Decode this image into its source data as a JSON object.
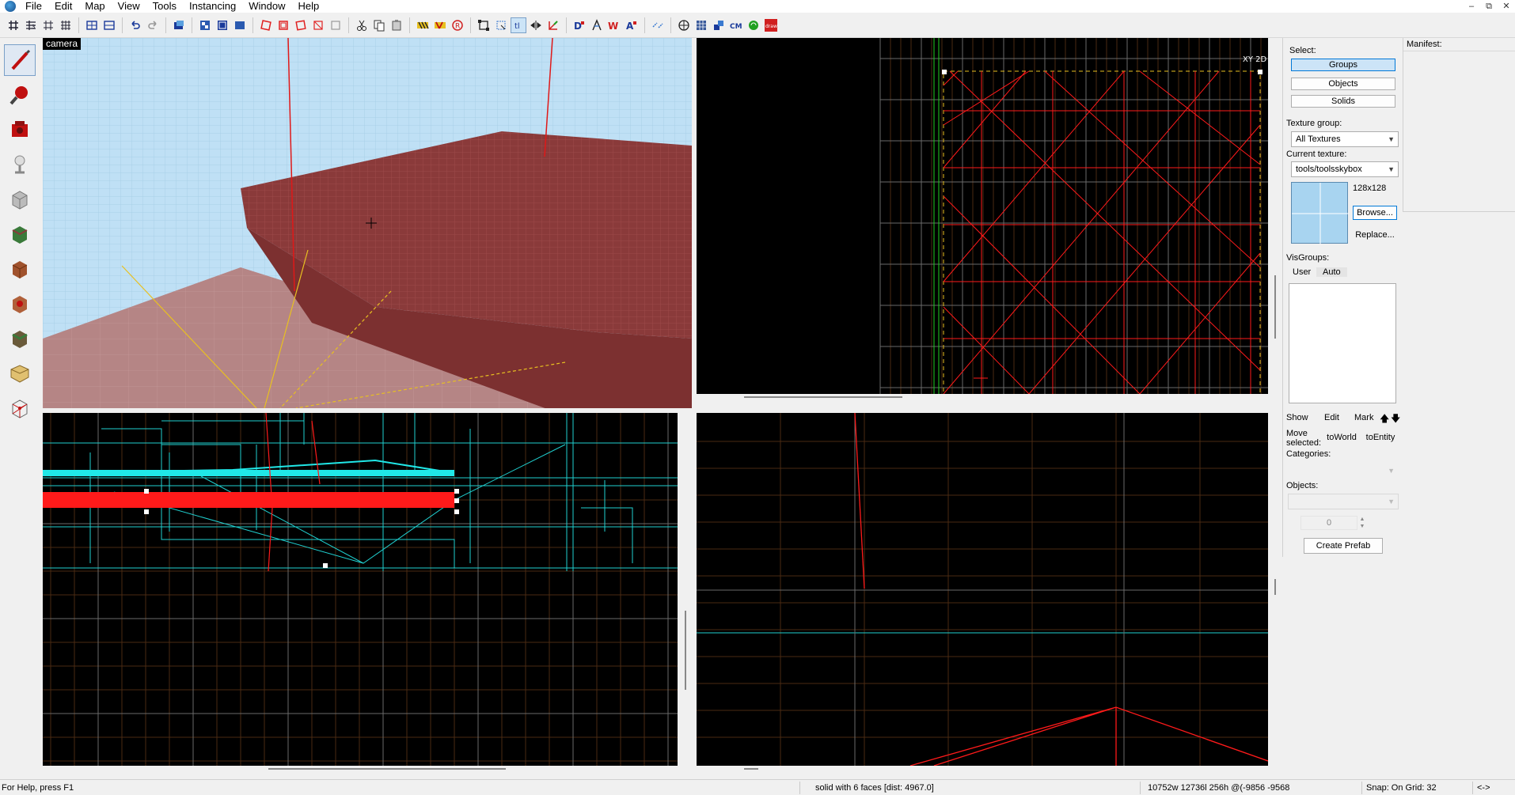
{
  "menu": {
    "items": [
      "File",
      "Edit",
      "Map",
      "View",
      "Tools",
      "Instancing",
      "Window",
      "Help"
    ]
  },
  "window_controls": {
    "minimize": "–",
    "restore": "⧉",
    "close": "✕"
  },
  "toolbar": {
    "icons": [
      "grid-toggle-icon",
      "grid-3d-icon",
      "grid-smaller-icon",
      "grid-larger-icon",
      "load-window-state-icon",
      "save-window-state-icon",
      "undo-icon",
      "redo-icon",
      "carve-icon",
      "group-icon",
      "ungroup-icon",
      "hide-icon",
      "unhide-icon",
      "toggle-visgroup-icon",
      "cut-icon",
      "copy-icon",
      "paste-icon",
      "texture-lock-icon",
      "texture-scale-icon",
      "autohide-icon",
      "selection-box-icon",
      "select-by-handles-icon",
      "texture-lock-2-icon",
      "flip-horizontal-icon",
      "flip-vertical-icon",
      "entity-report-icon",
      "check-problems-icon",
      "run-map-icon",
      "quick-hide-icon",
      "cordon-icon",
      "animation-icon",
      "smoothing-icon",
      "displacement-icon",
      "cubemap-icon",
      "sound-icon",
      "draw-icon"
    ],
    "cm_label": "CM",
    "draw_label": "draw"
  },
  "left_tools": [
    "selection-tool-icon",
    "magnify-tool-icon",
    "camera-tool-icon",
    "entity-tool-icon",
    "block-tool-icon",
    "toggle-texture-icon",
    "apply-texture-icon",
    "decal-tool-icon",
    "overlay-tool-icon",
    "clipping-tool-icon",
    "vertex-tool-icon"
  ],
  "viewports": {
    "camera_label": "camera",
    "top_right_label": "XY 2D"
  },
  "right_panel": {
    "select_label": "Select:",
    "groups_button": "Groups",
    "objects_button": "Objects",
    "solids_button": "Solids",
    "texture_group_label": "Texture group:",
    "texture_group_value": "All Textures",
    "current_texture_label": "Current texture:",
    "current_texture_value": "tools/toolsskybox",
    "texture_size": "128x128",
    "browse_button": "Browse...",
    "replace_button": "Replace...",
    "visgroups_label": "VisGroups:",
    "tab_user": "User",
    "tab_auto": "Auto",
    "show_button": "Show",
    "edit_button": "Edit",
    "mark_button": "Mark",
    "up_arrow": "🡅",
    "down_arrow": "🡇",
    "move_selected_label": "Move selected:",
    "to_world_button": "toWorld",
    "to_entity_button": "toEntity",
    "categories_label": "Categories:",
    "objects_label": "Objects:",
    "stepper_value": "0",
    "create_prefab_button": "Create Prefab"
  },
  "manifest": {
    "label": "Manifest:"
  },
  "status": {
    "help": "For Help, press F1",
    "selection": "solid with 6 faces   [dist: 4967.0]",
    "size": "10752w 12736l 256h @(-9856 -9568",
    "snap": "Snap: On Grid: 32",
    "arrows": "<->"
  },
  "colors": {
    "sky": "#bfe0f5",
    "brush_red": "#8a3a3a",
    "floor": "#b08080",
    "grid_orange": "#4a2a12",
    "grid_gray": "#6a6a6a",
    "selection_red": "#ff1a1a",
    "cyan": "#20d0d0",
    "yellow": "#e8c020"
  }
}
